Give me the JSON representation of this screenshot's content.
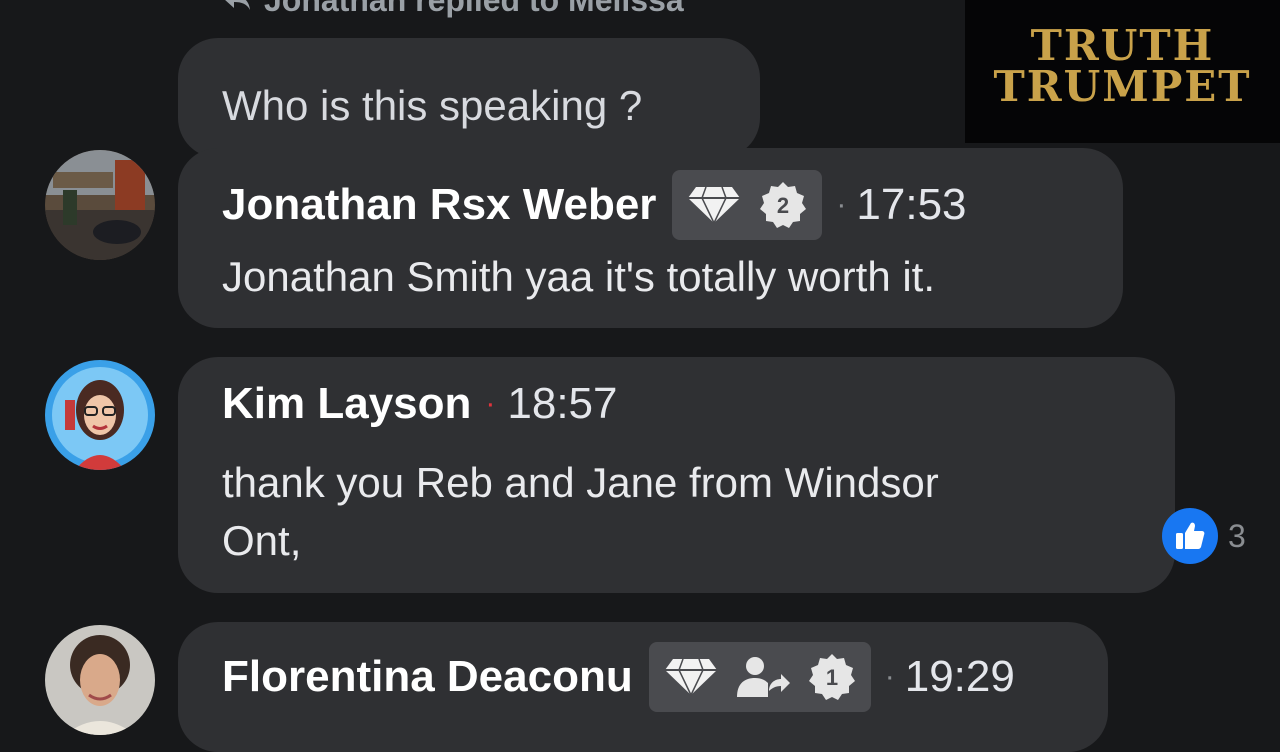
{
  "reply_line": {
    "text": "Jonathan replied to Melissa",
    "icon": "reply-arrow-icon"
  },
  "question_bubble": {
    "text": "Who is this speaking ?"
  },
  "logo": {
    "line1": "TRUTH",
    "line2": "TRUMPET",
    "color": "#c9a24a"
  },
  "comments": [
    {
      "name": "Jonathan Rsx Weber",
      "badges": [
        "diamond-icon",
        "level-badge-icon"
      ],
      "badge_number": "2",
      "separator": "·",
      "time": "17:53",
      "text": "Jonathan Smith yaa it's totally worth it."
    },
    {
      "name": "Kim Layson",
      "separator": "·",
      "time": "18:57",
      "text_line1": "thank you Reb and Jane from Windsor",
      "text_line2": "Ont,",
      "reaction": {
        "icon": "thumbs-up-icon",
        "count": "3",
        "color": "#1877f2"
      }
    },
    {
      "name": "Florentina Deaconu",
      "badges": [
        "diamond-icon",
        "user-share-icon",
        "level-badge-icon"
      ],
      "badge_number": "1",
      "separator": "·",
      "time": "19:29"
    }
  ],
  "colors": {
    "background": "#17181a",
    "bubble": "#2f3033",
    "accent": "#1877f2"
  }
}
